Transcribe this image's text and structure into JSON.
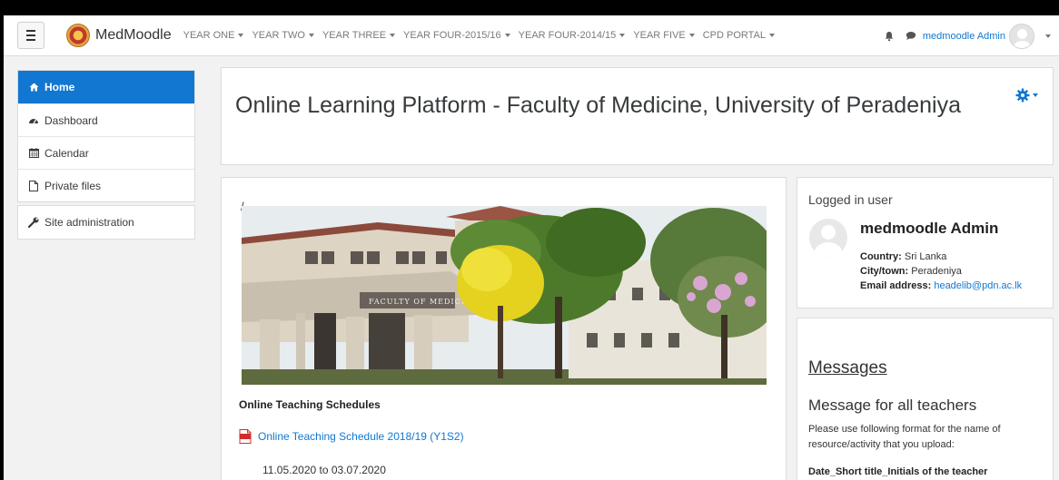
{
  "navbar": {
    "brand": "MedMoodle",
    "menu": [
      {
        "label": "YEAR ONE"
      },
      {
        "label": "YEAR TWO"
      },
      {
        "label": "YEAR THREE"
      },
      {
        "label": "YEAR FOUR-2015/16"
      },
      {
        "label": "YEAR FOUR-2014/15"
      },
      {
        "label": "YEAR FIVE"
      },
      {
        "label": "CPD PORTAL"
      }
    ],
    "username": "medmoodle Admin",
    "icons": [
      "menu-icon",
      "bell-icon",
      "chat-icon",
      "avatar",
      "chevron-down-icon"
    ]
  },
  "sidebar": {
    "items": [
      {
        "label": "Home",
        "icon": "home-icon"
      },
      {
        "label": "Dashboard",
        "icon": "dashboard-icon"
      },
      {
        "label": "Calendar",
        "icon": "calendar-icon"
      },
      {
        "label": "Private files",
        "icon": "file-icon"
      }
    ],
    "admin": {
      "label": "Site administration",
      "icon": "wrench-icon"
    }
  },
  "header": {
    "title": "Online Learning Platform - Faculty of Medicine, University of Peradeniya"
  },
  "main": {
    "slash": "/",
    "banner_sign": "FACULTY OF MEDICINE",
    "section_title": "Online Teaching Schedules",
    "link": "Online Teaching Schedule 2018/19 (Y1S2)",
    "dates": "11.05.2020 to 03.07.2020"
  },
  "user_block": {
    "title": "Logged in user",
    "fullname": "medmoodle Admin",
    "country_label": "Country:",
    "country": "Sri Lanka",
    "city_label": "City/town:",
    "city": "Peradeniya",
    "email_label": "Email address:",
    "email": "headelib@pdn.ac.lk"
  },
  "messages": {
    "heading": "Messages",
    "subheading": "Message for all teachers",
    "body": "Please use following format for the name of resource/activity that you upload:",
    "format": "Date_Short title_Initials of the teacher"
  },
  "colors": {
    "accent": "#1177d1",
    "page_bg": "#f2f2f2"
  }
}
